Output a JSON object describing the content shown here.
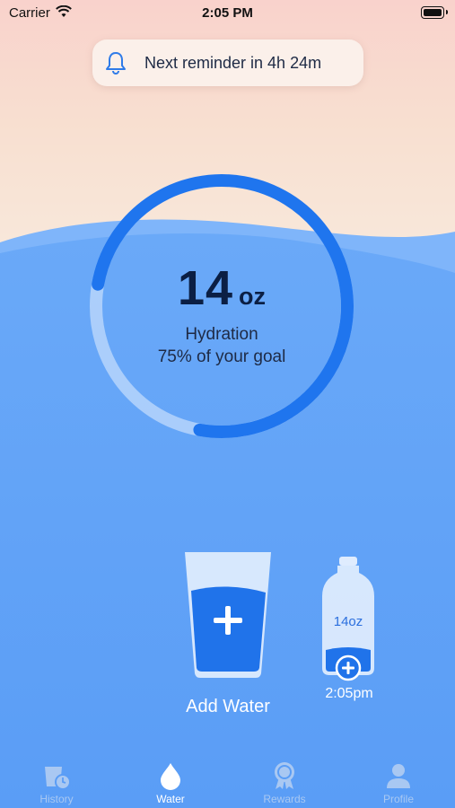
{
  "status_bar": {
    "carrier": "Carrier",
    "time": "2:05 PM"
  },
  "reminder": {
    "text": "Next reminder in 4h 24m",
    "icon": "bell-icon"
  },
  "progress": {
    "amount": "14",
    "unit": "oz",
    "label": "Hydration",
    "goal_text": "75% of your goal",
    "fraction": 0.75
  },
  "add_water": {
    "label": "Add Water",
    "icon": "plus-icon"
  },
  "bottle": {
    "amount": "14oz",
    "time": "2:05pm",
    "icon": "plus-icon"
  },
  "tabs": [
    {
      "label": "History",
      "icon": "history-icon",
      "active": false
    },
    {
      "label": "Water",
      "icon": "water-drop-icon",
      "active": true
    },
    {
      "label": "Rewards",
      "icon": "rewards-icon",
      "active": false
    },
    {
      "label": "Profile",
      "icon": "profile-icon",
      "active": false
    }
  ],
  "colors": {
    "accent": "#1f75ee",
    "water": "#5aa0f7",
    "tab_inactive": "#a9c8f2"
  }
}
